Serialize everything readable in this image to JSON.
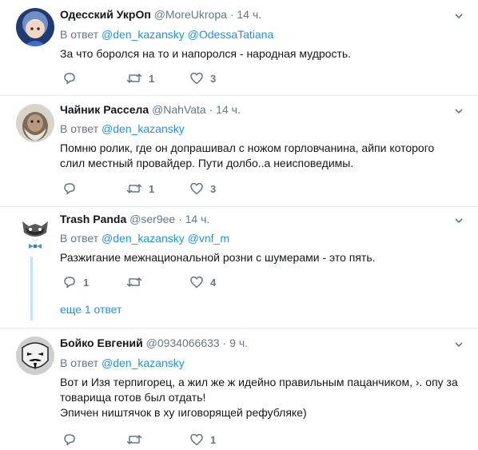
{
  "tweets": [
    {
      "name": "Одесский УкрОп",
      "handle": "@MoreUkropa",
      "time": "14 ч.",
      "reply_prefix": "В ответ",
      "mentions": [
        "@den_kazansky",
        "@OdessaTatiana"
      ],
      "lines": [
        "За что боролся на то и напоролся - народная мудрость."
      ],
      "retweets": "1",
      "likes": "3"
    },
    {
      "name": "Чайник Рассела",
      "handle": "@NahVata",
      "time": "14 ч.",
      "reply_prefix": "В ответ",
      "mentions": [
        "@den_kazansky"
      ],
      "lines": [
        "Помню ролик, где он допрашивал с ножом горловчанина, айпи которого",
        "слил местный провайдер.  Пути долбо..а неисповедимы."
      ],
      "retweets": "1",
      "likes": "3"
    },
    {
      "name": "Trash Panda",
      "handle": "@ser9ee",
      "time": "14 ч.",
      "reply_prefix": "В ответ",
      "mentions": [
        "@den_kazansky",
        "@vnf_m"
      ],
      "lines": [
        "Разжигание межнациональной розни с шумерами - это пять."
      ],
      "replies": "1",
      "likes": "4",
      "more_replies": "еще 1 ответ"
    },
    {
      "name": "Бойко Евгений",
      "handle": "@0934066633",
      "time": "9 ч.",
      "reply_prefix": "В ответ",
      "mentions": [
        "@den_kazansky"
      ],
      "lines": [
        "Вот и Изя терпигорец, а жил же ж идейно правильным пацанчиком, ›. опу за",
        "товарища готов был отдать!",
        "Эпичен ништячок в ху ıиговорящей рефубляке)"
      ],
      "likes": "1"
    }
  ],
  "dot": "·",
  "icons": {
    "reply": "reply-icon",
    "retweet": "retweet-icon",
    "like": "heart-icon",
    "caret": "chevron-down-icon"
  },
  "colors": {
    "accent": "#1b95e0",
    "muted": "#657786",
    "separator": "#e6ecf0"
  }
}
